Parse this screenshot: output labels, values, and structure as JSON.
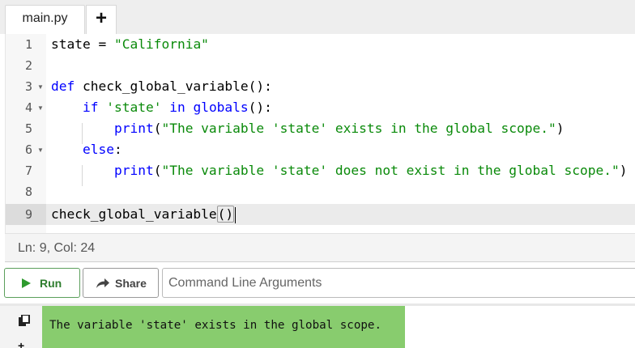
{
  "tabs": {
    "file": "main.py",
    "add": "+"
  },
  "editor": {
    "lines": [
      {
        "n": "1"
      },
      {
        "n": "2"
      },
      {
        "n": "3"
      },
      {
        "n": "4"
      },
      {
        "n": "5"
      },
      {
        "n": "6"
      },
      {
        "n": "7"
      },
      {
        "n": "8"
      },
      {
        "n": "9"
      }
    ],
    "tokens": {
      "l1_var": "state",
      "l1_op": " = ",
      "l1_str": "\"California\"",
      "l3_kw": "def",
      "l3_fn": " check_global_variable():",
      "l4_kw1": "if",
      "l4_str": " 'state'",
      "l4_kw2": " in",
      "l4_bi": " globals",
      "l4_end": "():",
      "l5_bi": "print",
      "l5_open": "(",
      "l5_str": "\"The variable 'state' exists in the global scope.\"",
      "l5_close": ")",
      "l6_kw": "else",
      "l6_colon": ":",
      "l7_bi": "print",
      "l7_open": "(",
      "l7_str": "\"The variable 'state' does not exist in the global scope.\"",
      "l7_close": ")",
      "l9_fn": "check_global_variable",
      "l9_paren": "()"
    }
  },
  "status": {
    "cursor": "Ln: 9,  Col: 24"
  },
  "controls": {
    "run_label": "Run",
    "share_label": "Share",
    "args_placeholder": "Command Line Arguments"
  },
  "output": {
    "text": "The variable 'state' exists in the global scope."
  },
  "colors": {
    "output_bg": "#88cc6e",
    "run_accent": "#2e9a2e"
  }
}
